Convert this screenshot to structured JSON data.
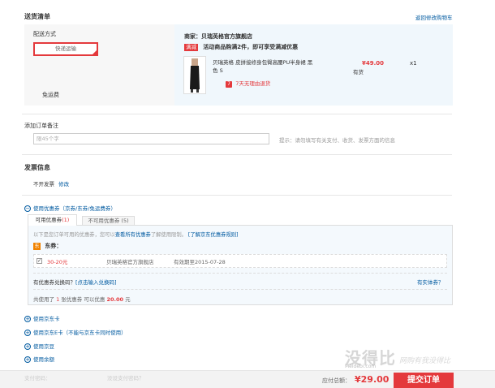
{
  "delivery": {
    "title": "送货清单",
    "back_link": "返回修改购物车",
    "method_label": "配送方式",
    "method_button": "快递运输",
    "free_shipping": "免运费"
  },
  "shop": {
    "name": "商家：贝瑞英格官方旗舰店",
    "promo_tag": "满减",
    "promo_text": "活动商品购满2件，即可享受满减优惠"
  },
  "product": {
    "name_line1": "贝瑞英格 皮拼接修身包臀高腰PU半身裙 黑",
    "name_line2": "色 S",
    "price": "¥49.00",
    "qty": "x1",
    "stock": "有货",
    "return_icon": "7",
    "return_policy": "7天无理由退货"
  },
  "remark": {
    "label": "添加订单备注",
    "placeholder": "限45个字",
    "tip": "提示：请勿填写有关支付、收货、发票方面的信息"
  },
  "invoice": {
    "title": "发票信息",
    "status": "不开发票",
    "edit": "修改"
  },
  "coupons": {
    "toggle_label": "使用优惠券（京券/东券/免运费券）",
    "tab_available_label": "可用优惠券",
    "tab_available_count": "(1)",
    "tab_unavailable": "不可用优惠券 (5)",
    "info_prefix": "以下是您订单可用的优惠券，您可以",
    "info_link1": "查看所有优惠券",
    "info_mid": "了解使用限制。",
    "info_link2": "[了解京东优惠券规则]",
    "group_badge": "东",
    "group_label": "东券：",
    "item": {
      "checked": "✓",
      "amount": "30-20元",
      "shop": "贝瑞英格官方旗舰店",
      "validity": "有效期至2015-07-28"
    },
    "exchange_prefix": "有优惠券兑换码？",
    "exchange_link": "[点击输入兑换码]",
    "physical": "有实体券？",
    "summary_prefix": "共使用了",
    "summary_count": "1",
    "summary_mid": "张优惠券  可以优惠",
    "summary_amount": "20.00",
    "summary_unit": "元"
  },
  "payment_options": [
    "使用京东卡",
    "使用京东E卡（不能与京东卡同时使用）",
    "使用京豆",
    "使用余额"
  ],
  "bottom": {
    "left_hint1": "支付密码：",
    "left_hint2": "没设支付密码？",
    "total_label": "应付总额：",
    "total_amount": "¥29.00",
    "submit": "提交订单"
  },
  "watermark": {
    "logo": "没得比",
    "sub": "Meidebi.com",
    "slogan": "网购有我没得比"
  },
  "colors": {
    "accent_red": "#e4393c",
    "link_blue": "#005aa0",
    "jd_orange": "#f08200"
  }
}
